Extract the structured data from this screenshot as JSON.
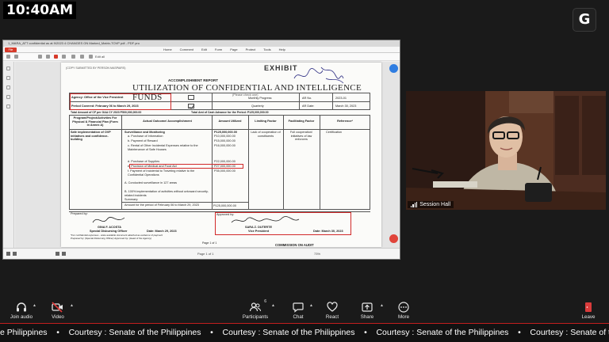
{
  "overlay": {
    "clock": "10:40AM",
    "channel_logo": "G"
  },
  "pdf_viewer": {
    "titlebar": "1_MARA_ATT confidential as at 9/2023 4 CHANGES ON Marked_Matrix-TOVP pdf - PDF pro",
    "file_button": "File",
    "menu": [
      "Home",
      "Comment",
      "Edit",
      "Form",
      "Page",
      "Protect",
      "Tools",
      "Help"
    ],
    "active_menu": "Home",
    "edit_all": "Edit all",
    "page_indicator": "Page 1 of 1",
    "zoom": "73%"
  },
  "document": {
    "exhibit": "EXHIBIT",
    "top_left_note": "(COPY SUBMITTED BY PERSON MASPAIRS)",
    "report_label": "ACCOMPLISHMENT REPORT",
    "title": "UTILIZATION OF CONFIDENTIAL AND INTELLIGENCE FUNDS",
    "please_check": "(Please check one)",
    "agency": "Agency: Office of the Vice President",
    "period": "Period Covered: February 06 to March 29, 2023",
    "total_amount": "Total Amount of CF per GAA CY 2023 P500,000,000.00",
    "total_cash": "Total Amt of Cash Advance for the Period: P125,000,000.00",
    "monthly": "Monthly Progress",
    "quarterly": "Quarterly",
    "ar_no_label": "AR No.",
    "ar_no": "2023-01",
    "ar_date_label": "AR Date:",
    "ar_date": "March 30, 2023",
    "headers": {
      "program": "Program/Project/Activities For Physical & Financial Plan (Form in Annex A)",
      "outcome": "Actual Outcome/ Accomplishment",
      "amount": "Amount Utilized",
      "limiting": "Limiting Factor",
      "facilitating": "Facilitating Factor",
      "reference": "Reference*"
    },
    "program_text": "Safe implementation of OVP initiatives and confidence-building",
    "surveillance": "Surveillance and Monitoring",
    "items": [
      "a. Purchase of Information",
      "b. Payment of Reward",
      "c. Rental of Other Incidental Expenses relative to the Maintenance of Safe Houses",
      "d. Purchase of Supplies",
      "e. Provision of Medical and Food Aid",
      "f. Payment of Incidental to Traveling relative to the Confidential Operations"
    ],
    "amounts": [
      "P125,000,000.00",
      "P10,000,000.00",
      "P15,000,000.00",
      "P16,000,000.00",
      "P22,000,000.00",
      "P27,000,000.00",
      "P35,000,000.00"
    ],
    "limiting": "Lack of cooperation of constituents",
    "facilitating": "Full cooperation/ initiatives of law enforcers",
    "reference": "Certification",
    "conducted": "A. Conducted surveillance in 127 areas",
    "implementation": "B. 100% implementation of activities without untoward security-related incidents",
    "summary": "Summary:",
    "amount_used": "Amount for the period of February 06 to March 29, 2023",
    "amount_used_value": "P125,000,000.00",
    "prepared_by": "Prepared by:",
    "preparer_name": "GINA F. ACOSTA",
    "preparer_title": "Special Disbursing Officer",
    "prepared_date": "Date: March 29, 2023",
    "approved_by": "Approved by:",
    "approver_name": "SARA Z. DUTERTE",
    "approver_title": "Vice President",
    "approved_date": "Date: March 30, 2023",
    "footnote": "*For confidential expenses - state available document attached as evidence of payment",
    "footnote2": "Prepared by: (Special Disbursing Officer) Approved by: (Head of the Agency)",
    "page_footer": "Page 1 of 1",
    "coa_stamp": "COMMISSION ON AUDIT"
  },
  "camera": {
    "label": "Session Hall"
  },
  "toolbar": {
    "join_audio": "Join audio",
    "video": "Video",
    "participants": "Participants",
    "participants_count": "6",
    "chat": "Chat",
    "react": "React",
    "share": "Share",
    "more": "More",
    "leave": "Leave"
  },
  "ticker": {
    "items": [
      "e Philippines",
      "Courtesy : Senate of the Philippines",
      "Courtesy : Senate of the Philippines",
      "Courtesy : Senate of the Philippines",
      "Courtesy : Senate of the Philippines"
    ],
    "separator": "•"
  },
  "colors": {
    "zoom_bg": "#1a1a1a",
    "ticker_line": "#c21e1e",
    "annotation_red": "#d12a2a",
    "pdf_accent": "#d73a2a"
  }
}
